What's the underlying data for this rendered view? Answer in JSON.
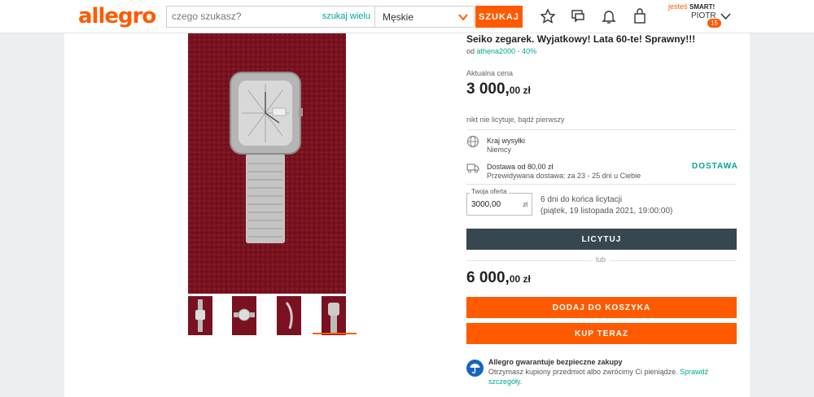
{
  "header": {
    "logo": "allegro",
    "search": {
      "placeholder": "czego szukasz?",
      "value": "",
      "many_link": "szukaj wielu"
    },
    "category": {
      "selected": "Męskie"
    },
    "search_button": "SZUKAJ",
    "icons": [
      "star-icon",
      "chat-icon",
      "bell-icon",
      "bag-icon"
    ],
    "smart": {
      "prefix": "jesteś",
      "label": "SMART!"
    },
    "user": {
      "name": "PIOTR",
      "badge": "15"
    },
    "brand_color": "#ff5a00",
    "link_color": "#00a790"
  },
  "gallery": {
    "thumbnails": [
      "thumb-1",
      "thumb-2",
      "thumb-3",
      "thumb-4"
    ],
    "selected_index": 3
  },
  "product": {
    "title": "Seiko zegarek. Wyjatkowy! Lata 60-te! Sprawny!!!",
    "seller_prefix": "od",
    "seller": "athena2000 - 40%",
    "current_price_label": "Aktualna cena",
    "current_price_main": "3 000,",
    "current_price_cents": "00 zł",
    "bids_info": "nikt nie licytuje, bądź pierwszy"
  },
  "shipping": {
    "country_label": "Kraj wysyłki",
    "country": "Niemcy",
    "delivery_from": "Dostawa od 80,00 zł",
    "delivery_eta": "Przewidywana dostawa: za 23 - 25 dni u Ciebie",
    "delivery_link": "DOSTAWA"
  },
  "bid": {
    "legend": "Twoja oferta",
    "value": "3000,00",
    "unit": "zł",
    "time_left": "6 dni do końca licytacji",
    "end_date": "(piątek, 19 listopada 2021, 19:00:00)",
    "button": "LICYTUJ"
  },
  "or_text": "lub",
  "buy_now": {
    "price_main": "6 000,",
    "price_cents": "00 zł",
    "cart_button": "DODAJ DO KOSZYKA",
    "buy_button": "KUP TERAZ"
  },
  "guarantee": {
    "title": "Allegro gwarantuje bezpieczne zakupy",
    "text": "Otrzymasz kupiony przedmiot albo zwrócimy Ci pieniądze.",
    "link": "Sprawdź szczegóły."
  }
}
